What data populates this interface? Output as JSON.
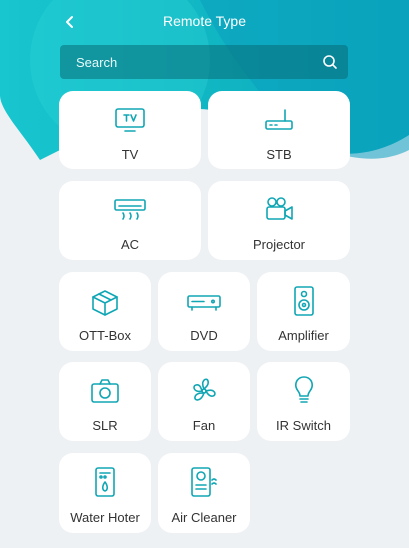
{
  "header": {
    "title": "Remote Type",
    "back_icon": "chevron-left-icon"
  },
  "search": {
    "placeholder": "Search",
    "icon": "search-icon"
  },
  "colors": {
    "accent": "#10a6b4",
    "header_gradient_start": "#00c2cb",
    "header_gradient_end": "#0a9cb8",
    "background": "#eef1f4"
  },
  "remote_types": [
    {
      "label": "TV",
      "icon": "tv-icon"
    },
    {
      "label": "STB",
      "icon": "set-top-box-icon"
    },
    {
      "label": "AC",
      "icon": "air-conditioner-icon"
    },
    {
      "label": "Projector",
      "icon": "projector-icon"
    },
    {
      "label": "OTT-Box",
      "icon": "box-icon"
    },
    {
      "label": "DVD",
      "icon": "dvd-player-icon"
    },
    {
      "label": "Amplifier",
      "icon": "speaker-icon"
    },
    {
      "label": "SLR",
      "icon": "camera-icon"
    },
    {
      "label": "Fan",
      "icon": "fan-icon"
    },
    {
      "label": "IR Switch",
      "icon": "lightbulb-icon"
    },
    {
      "label": "Water Hoter",
      "icon": "water-heater-icon"
    },
    {
      "label": "Air Cleaner",
      "icon": "air-cleaner-icon"
    }
  ]
}
